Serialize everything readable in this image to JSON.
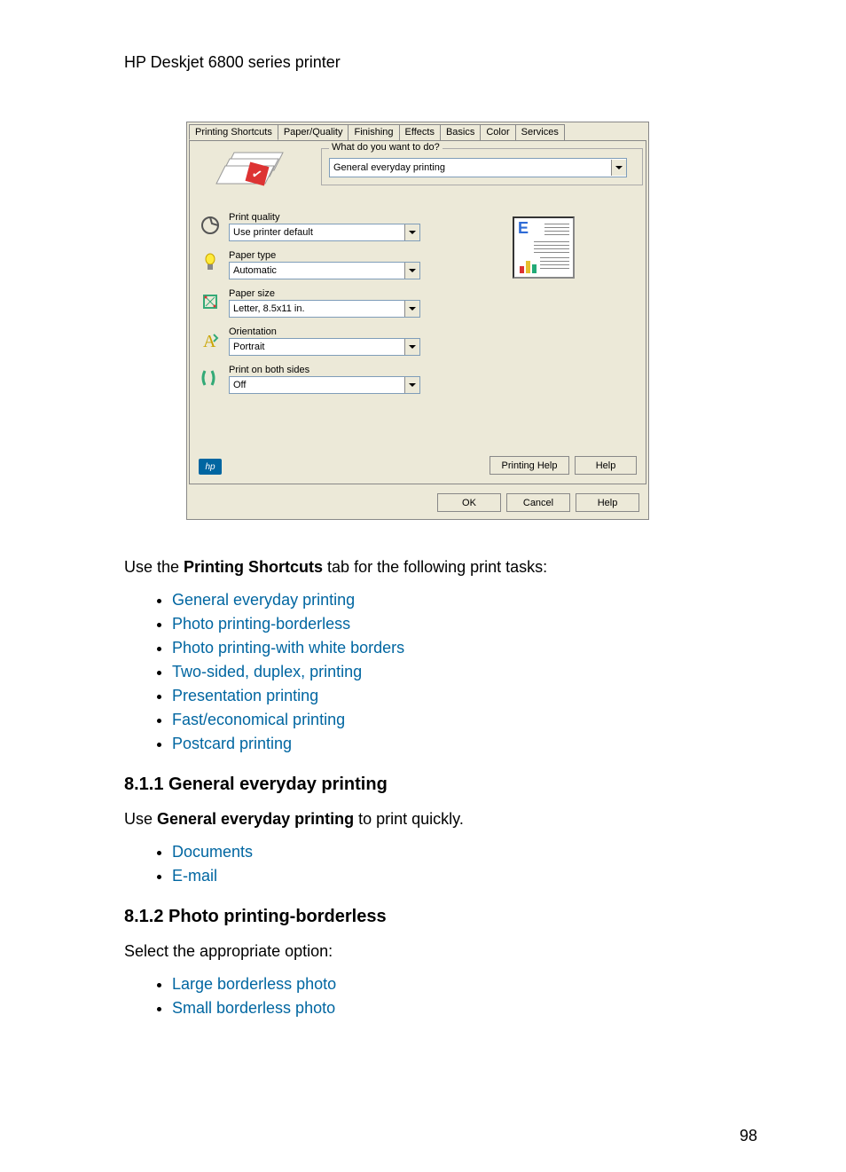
{
  "header": {
    "title": "HP Deskjet 6800 series printer"
  },
  "dialog": {
    "tabs": [
      "Printing Shortcuts",
      "Paper/Quality",
      "Finishing",
      "Effects",
      "Basics",
      "Color",
      "Services"
    ],
    "active_tab": 0,
    "group_label": "What do you want to do?",
    "main_select": "General everyday printing",
    "controls": [
      {
        "label": "Print quality",
        "value": "Use printer default"
      },
      {
        "label": "Paper type",
        "value": "Automatic"
      },
      {
        "label": "Paper size",
        "value": "Letter, 8.5x11 in."
      },
      {
        "label": "Orientation",
        "value": "Portrait"
      },
      {
        "label": "Print on both sides",
        "value": "Off"
      }
    ],
    "panel_buttons": {
      "printing_help": "Printing Help",
      "help": "Help"
    },
    "dialog_buttons": {
      "ok": "OK",
      "cancel": "Cancel",
      "help": "Help"
    },
    "hp_logo_text": "hp"
  },
  "intro": {
    "pre": "Use the ",
    "bold": "Printing Shortcuts",
    "post": " tab for the following print tasks:"
  },
  "task_links": [
    "General everyday printing",
    "Photo printing-borderless",
    "Photo printing-with white borders",
    "Two-sided, duplex, printing",
    "Presentation printing",
    "Fast/economical printing",
    "Postcard printing"
  ],
  "sec_811": {
    "heading": "8.1.1  General everyday printing",
    "pre": "Use ",
    "bold": "General everyday printing",
    "post": " to print quickly.",
    "links": [
      "Documents",
      "E-mail"
    ]
  },
  "sec_812": {
    "heading": "8.1.2  Photo printing-borderless",
    "text": "Select the appropriate option:",
    "links": [
      "Large borderless photo",
      "Small borderless photo"
    ]
  },
  "page_number": "98"
}
